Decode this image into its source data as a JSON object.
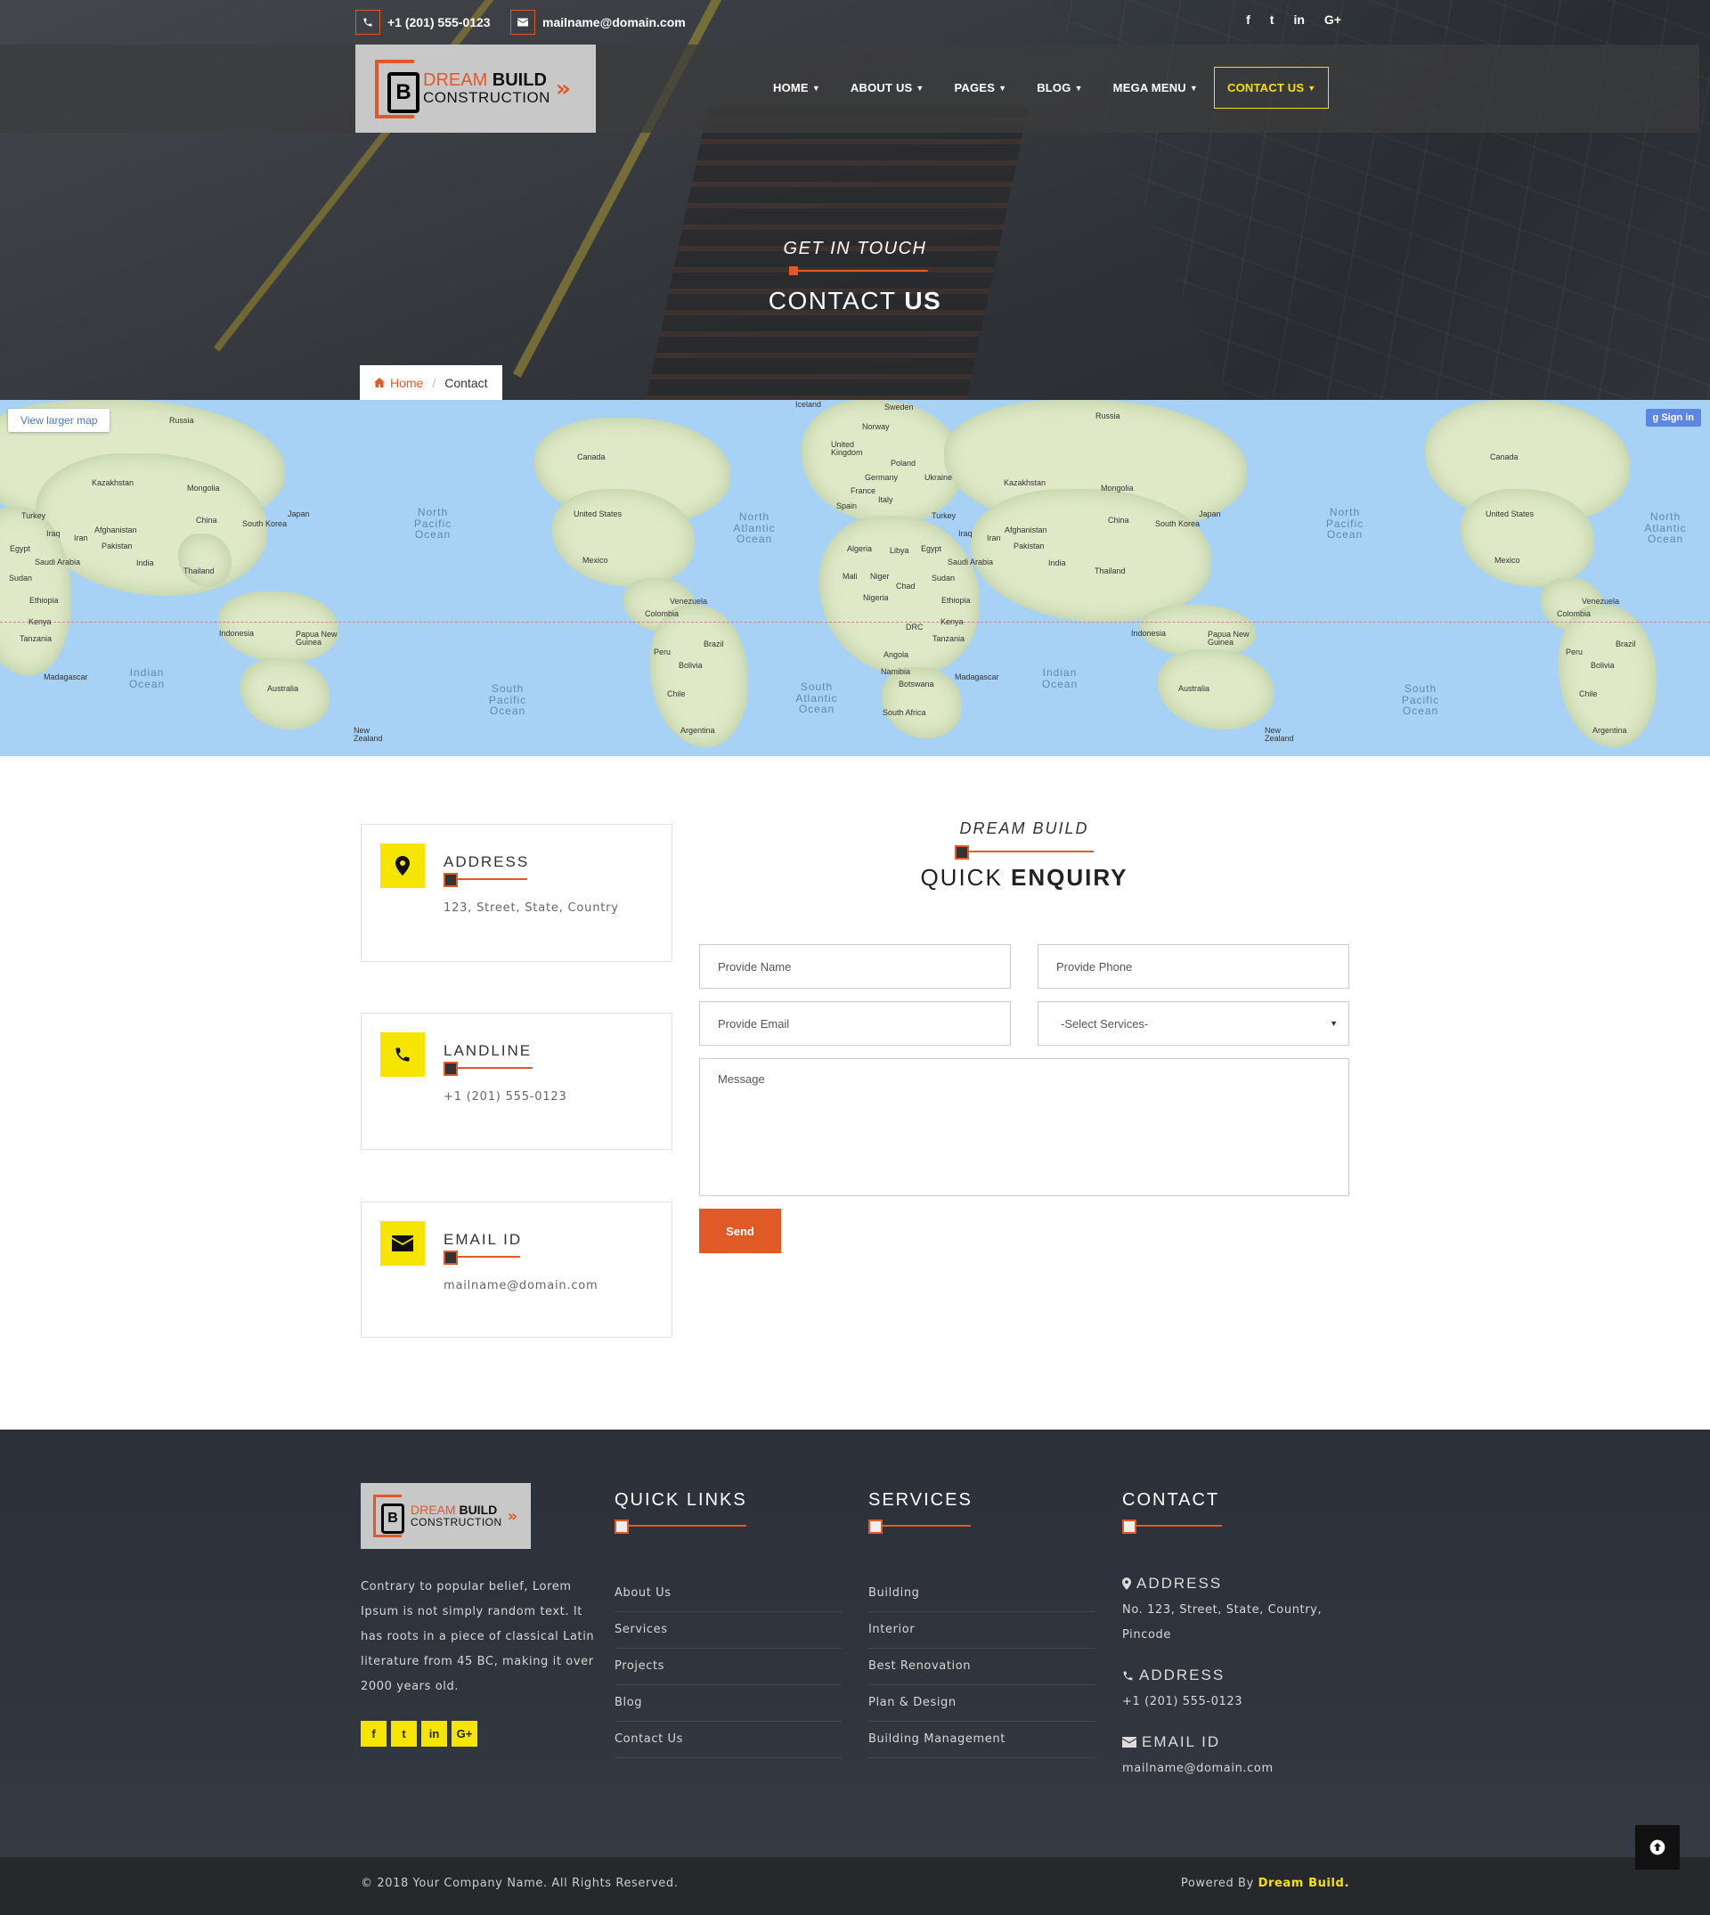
{
  "topbar": {
    "phone": "+1 (201) 555-0123",
    "email": "mailname@domain.com",
    "social": [
      "f",
      "t",
      "in",
      "G+"
    ]
  },
  "logo": {
    "word1": "DREAM",
    "word2": "BUILD",
    "word3": "CONSTRUCTION"
  },
  "nav": {
    "items": [
      "HOME",
      "ABOUT US",
      "PAGES",
      "BLOG",
      "MEGA MENU"
    ],
    "active": "CONTACT US"
  },
  "hero": {
    "subtitle": "GET IN TOUCH",
    "title_light": "CONTACT",
    "title_bold": "US"
  },
  "breadcrumb": {
    "home": "Home",
    "current": "Contact"
  },
  "map": {
    "view_larger": "View larger map",
    "sign_in": "Sign in",
    "labels": [
      "Russia",
      "Kazakhstan",
      "Mongolia",
      "China",
      "Japan",
      "South Korea",
      "Turkey",
      "Iraq",
      "Iran",
      "Afghanistan",
      "Pakistan",
      "India",
      "Thailand",
      "Egypt",
      "Saudi Arabia",
      "Sudan",
      "Ethiopia",
      "Kenya",
      "Tanzania",
      "Madagascar",
      "Indonesia",
      "Papua New Guinea",
      "Australia",
      "New Zealand",
      "Canada",
      "United States",
      "Mexico",
      "Colombia",
      "Venezuela",
      "Peru",
      "Brazil",
      "Bolivia",
      "Chile",
      "Argentina",
      "Iceland",
      "Sweden",
      "Norway",
      "United Kingdom",
      "Poland",
      "Germany",
      "France",
      "Ukraine",
      "Italy",
      "Spain",
      "Algeria",
      "Libya",
      "Mali",
      "Niger",
      "Chad",
      "Nigeria",
      "DRC",
      "Angola",
      "Namibia",
      "Botswana",
      "South Africa",
      "Ukraine"
    ],
    "oceans": [
      "North Pacific Ocean",
      "North Atlantic Ocean",
      "Indian Ocean",
      "South Pacific Ocean",
      "South Atlantic Ocean"
    ]
  },
  "cards": [
    {
      "title": "ADDRESS",
      "value": "123, Street, State, Country",
      "icon": "map-marker-icon"
    },
    {
      "title": "LANDLINE",
      "value": "+1 (201) 555-0123",
      "icon": "phone-icon"
    },
    {
      "title": "EMAIL ID",
      "value": "mailname@domain.com",
      "icon": "envelope-icon"
    }
  ],
  "enquiry": {
    "subtitle": "DREAM BUILD",
    "title_light": "QUICK",
    "title_bold": "ENQUIRY",
    "name_placeholder": "Provide Name",
    "phone_placeholder": "Provide Phone",
    "email_placeholder": "Provide Email",
    "service_selected": "-Select Services-",
    "message_placeholder": "Message",
    "send": "Send"
  },
  "footer": {
    "about": "Contrary to popular belief, Lorem Ipsum is not simply random text. It has roots in a piece of classical Latin literature from 45 BC, making it over 2000 years old.",
    "social": [
      "f",
      "t",
      "in",
      "G+"
    ],
    "quick_links_title": "QUICK LINKS",
    "quick_links": [
      "About Us",
      "Services",
      "Projects",
      "Blog",
      "Contact Us"
    ],
    "services_title": "SERVICES",
    "services": [
      "Building",
      "Interior",
      "Best Renovation",
      "Plan & Design",
      "Building Management"
    ],
    "contact_title": "CONTACT",
    "address_label": "ADDRESS",
    "address_value": "No. 123, Street, State, Country, Pincode",
    "phone_label": "ADDRESS",
    "phone_value": "+1 (201) 555-0123",
    "email_label": "EMAIL ID",
    "email_value": "mailname@domain.com"
  },
  "bottom": {
    "copyright": "© 2018 Your Company Name. All Rights Reserved.",
    "powered_prefix": "Powered By ",
    "powered_brand": "Dream Build."
  },
  "colors": {
    "accent": "#e05a28",
    "yellow": "#f6e500",
    "footer_bg": "#2c303a"
  }
}
